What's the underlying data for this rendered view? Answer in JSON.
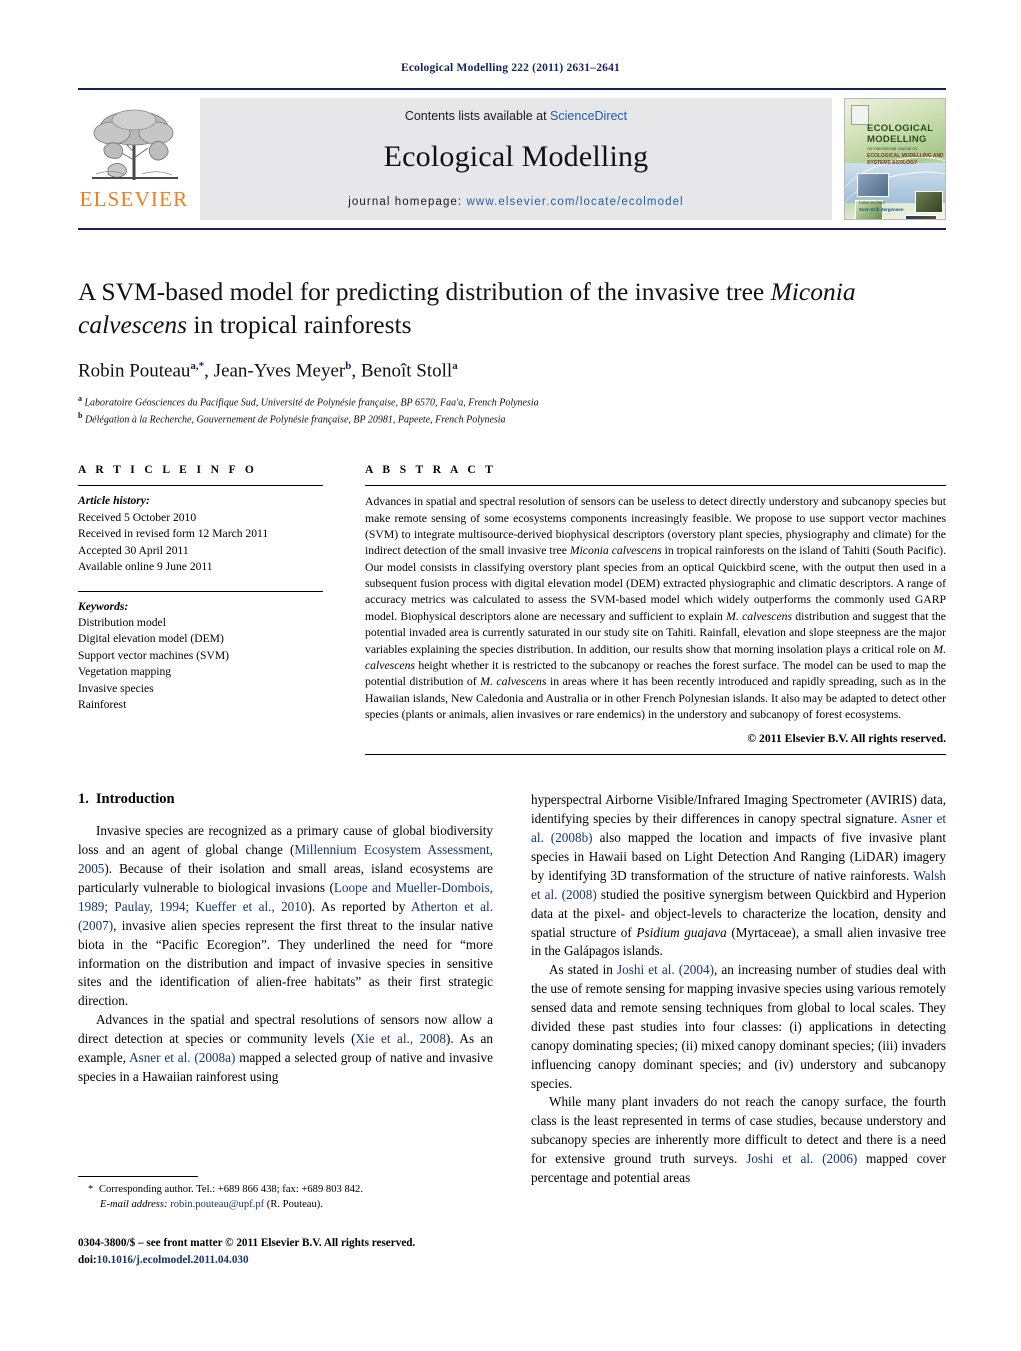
{
  "running_head": "Ecological Modelling 222 (2011) 2631–2641",
  "masthead": {
    "publisher": "ELSEVIER",
    "contents_prefix": "Contents lists available at ",
    "contents_link": "ScienceDirect",
    "journal_title": "Ecological Modelling",
    "homepage_prefix": "journal homepage: ",
    "homepage_url": "www.elsevier.com/locate/ecolmodel",
    "cover": {
      "line1": "ECOLOGICAL",
      "line2": "MODELLING",
      "line3": "An International Journal on",
      "line4": "ECOLOGICAL MODELLING AND\nSYSTEMS ECOLOGY",
      "footer1": "Editor-in-Chief",
      "footer2": "Sven Erik Jørgensen"
    }
  },
  "article": {
    "title_part1": "A SVM-based model for predicting distribution of the invasive tree ",
    "title_italic1": "Miconia",
    "title_italic2": "calvescens",
    "title_part2": " in tropical rainforests",
    "authors": [
      {
        "name": "Robin Pouteau",
        "sup": "a,*"
      },
      {
        "name": "Jean-Yves Meyer",
        "sup": "b"
      },
      {
        "name": "Benoît Stoll",
        "sup": "a"
      }
    ],
    "affiliations": [
      {
        "marker": "a",
        "text": "Laboratoire Géosciences du Pacifique Sud, Université de Polynésie française, BP 6570, Faa'a, French Polynesia"
      },
      {
        "marker": "b",
        "text": "Délégation à la Recherche, Gouvernement de Polynésie française, BP 20981, Papeete, French Polynesia"
      }
    ]
  },
  "article_info": {
    "heading": "A R T I C L E   I N F O",
    "history_label": "Article history:",
    "history": [
      "Received 5 October 2010",
      "Received in revised form 12 March 2011",
      "Accepted 30 April 2011",
      "Available online 9 June 2011"
    ],
    "keywords_label": "Keywords:",
    "keywords": [
      "Distribution model",
      "Digital elevation model (DEM)",
      "Support vector machines (SVM)",
      "Vegetation mapping",
      "Invasive species",
      "Rainforest"
    ]
  },
  "abstract": {
    "heading": "A B S T R A C T",
    "p1": "Advances in spatial and spectral resolution of sensors can be useless to detect directly understory and subcanopy species but make remote sensing of some ecosystems components increasingly feasible. We propose to use support vector machines (SVM) to integrate multisource-derived biophysical descriptors (overstory plant species, physiography and climate) for the indirect detection of the small invasive tree ",
    "sp1": "Miconia calvescens",
    "p2": " in tropical rainforests on the island of Tahiti (South Pacific). Our model consists in classifying overstory plant species from an optical Quickbird scene, with the output then used in a subsequent fusion process with digital elevation model (DEM) extracted physiographic and climatic descriptors. A range of accuracy metrics was calculated to assess the SVM-based model which widely outperforms the commonly used GARP model. Biophysical descriptors alone are necessary and sufficient to explain ",
    "sp2": "M. calvescens",
    "p3": " distribution and suggest that the potential invaded area is currently saturated in our study site on Tahiti. Rainfall, elevation and slope steepness are the major variables explaining the species distribution. In addition, our results show that morning insolation plays a critical role on ",
    "sp3": "M. calvescens",
    "p4": " height whether it is restricted to the subcanopy or reaches the forest surface. The model can be used to map the potential distribution of ",
    "sp4": "M. calvescens",
    "p5": " in areas where it has been recently introduced and rapidly spreading, such as in the Hawaiian islands, New Caledonia and Australia or in other French Polynesian islands. It also may be adapted to detect other species (plants or animals, alien invasives or rare endemics) in the understory and subcanopy of forest ecosystems.",
    "copyright": "© 2011 Elsevier B.V. All rights reserved."
  },
  "introduction": {
    "number": "1.",
    "title": "Introduction",
    "left_p1_a": "Invasive species are recognized as a primary cause of global biodiversity loss and an agent of global change (",
    "left_p1_ref1": "Millennium Ecosystem Assessment, 2005",
    "left_p1_b": "). Because of their isolation and small areas, island ecosystems are particularly vulnerable to biological invasions (",
    "left_p1_ref2": "Loope and Mueller-Dombois, 1989; Paulay, 1994; Kueffer et al., 2010",
    "left_p1_c": "). As reported by ",
    "left_p1_ref3": "Atherton et al. (2007)",
    "left_p1_d": ", invasive alien species represent the first threat to the insular native biota in the “Pacific Ecoregion”. They underlined the need for “more information on the distribution and impact of invasive species in sensitive sites and the identification of alien-free habitats” as their first strategic direction.",
    "left_p2_a": "Advances in the spatial and spectral resolutions of sensors now allow a direct detection at species or community levels (",
    "left_p2_ref1": "Xie et al., 2008",
    "left_p2_b": "). As an example, ",
    "left_p2_ref2": "Asner et al. (2008a)",
    "left_p2_c": " mapped a selected group of native and invasive species in a Hawaiian rainforest using",
    "right_p1_a": "hyperspectral Airborne Visible/Infrared Imaging Spectrometer (AVIRIS) data, identifying species by their differences in canopy spectral signature. ",
    "right_p1_ref1": "Asner et al. (2008b)",
    "right_p1_b": " also mapped the location and impacts of five invasive plant species in Hawaii based on Light Detection And Ranging (LiDAR) imagery by identifying 3D transformation of the structure of native rainforests. ",
    "right_p1_ref2": "Walsh et al. (2008)",
    "right_p1_c": " studied the positive synergism between Quickbird and Hyperion data at the pixel- and object-levels to characterize the location, density and spatial structure of ",
    "right_p1_sp": "Psidium guajava",
    "right_p1_d": " (Myrtaceae), a small alien invasive tree in the Galápagos islands.",
    "right_p2_a": "As stated in ",
    "right_p2_ref1": "Joshi et al. (2004)",
    "right_p2_b": ", an increasing number of studies deal with the use of remote sensing for mapping invasive species using various remotely sensed data and remote sensing techniques from global to local scales. They divided these past studies into four classes: (i) applications in detecting canopy dominating species; (ii) mixed canopy dominant species; (iii) invaders influencing canopy dominant species; and (iv) understory and subcanopy species.",
    "right_p3_a": "While many plant invaders do not reach the canopy surface, the fourth class is the least represented in terms of case studies, because understory and subcanopy species are inherently more difficult to detect and there is a need for extensive ground truth surveys. ",
    "right_p3_ref1": "Joshi et al. (2006)",
    "right_p3_b": " mapped cover percentage and potential areas"
  },
  "footnote": {
    "star": "*",
    "corresponding": " Corresponding author. Tel.: +689 866 438; fax: +689 803 842.",
    "email_label": "E-mail address:",
    "email": "robin.pouteau@upf.pf",
    "email_suffix": " (R. Pouteau).",
    "issn_line": "0304-3800/$ – see front matter © 2011 Elsevier B.V. All rights reserved.",
    "doi_label": "doi:",
    "doi": "10.1016/j.ecolmodel.2011.04.030"
  },
  "colors": {
    "navy": "#16215b",
    "link": "#1b5fa8",
    "ref": "#16356f",
    "elsevier_orange": "#f07d20",
    "band_gray": "#e7e7e9"
  }
}
